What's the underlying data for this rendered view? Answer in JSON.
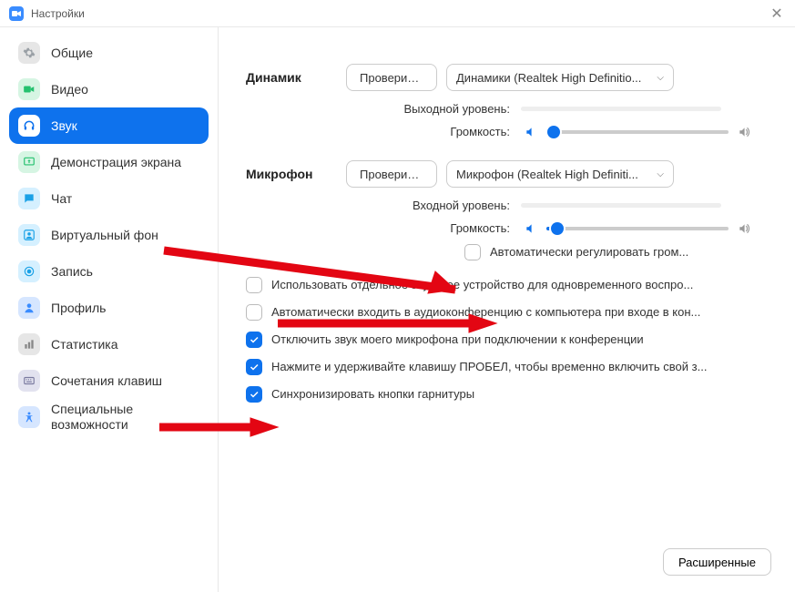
{
  "titlebar": {
    "title": "Настройки"
  },
  "sidebar": {
    "items": [
      {
        "label": "Общие"
      },
      {
        "label": "Видео"
      },
      {
        "label": "Звук"
      },
      {
        "label": "Демонстрация экрана"
      },
      {
        "label": "Чат"
      },
      {
        "label": "Виртуальный фон"
      },
      {
        "label": "Запись"
      },
      {
        "label": "Профиль"
      },
      {
        "label": "Статистика"
      },
      {
        "label": "Сочетания клавиш"
      },
      {
        "label": "Специальные возможности"
      }
    ]
  },
  "speaker": {
    "label": "Динамик",
    "test_button": "Проверить ...",
    "device": "Динамики (Realtek High Definitio...",
    "output_level_label": "Выходной уровень:",
    "volume_label": "Громкость:",
    "volume_percent": 4
  },
  "mic": {
    "label": "Микрофон",
    "test_button": "Проверить ...",
    "device": "Микрофон (Realtek High Definiti...",
    "input_level_label": "Входной уровень:",
    "volume_label": "Громкость:",
    "volume_percent": 6,
    "auto_adjust_label": "Автоматически регулировать гром..."
  },
  "options": [
    {
      "checked": false,
      "label": "Использовать отдельное звуковое устройство для одновременного воспро..."
    },
    {
      "checked": false,
      "label": "Автоматически входить в аудиоконференцию с компьютера при входе в кон..."
    },
    {
      "checked": true,
      "label": "Отключить звук моего микрофона при подключении к конференции"
    },
    {
      "checked": true,
      "label": "Нажмите и удерживайте клавишу ПРОБЕЛ, чтобы временно включить свой з..."
    },
    {
      "checked": true,
      "label": "Синхронизировать кнопки гарнитуры"
    }
  ],
  "advanced_button": "Расширенные"
}
